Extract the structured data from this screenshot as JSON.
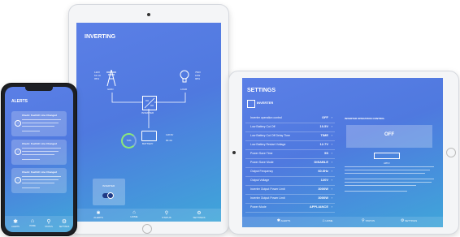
{
  "center_tablet": {
    "title": "INVERTING",
    "grid_values": [
      "120V",
      "61.1A",
      "95%"
    ],
    "load_values": [
      "750V",
      "10W",
      "98%"
    ],
    "inverter_label": "INVERTER",
    "battery_label": "BATTERY",
    "battery_percent": "73%",
    "battery_values": [
      "118.9V",
      "90.4A"
    ],
    "grid_label": "GRID",
    "load_label": "LOAD",
    "toggle_label": "INVERTER",
    "nav": [
      "ALERTS",
      "HOME",
      "STATUS",
      "SETTINGS"
    ]
  },
  "right_tablet": {
    "title": "SETTINGS",
    "subtitle": "INVERTER",
    "rows": [
      {
        "label": "Inverter operation control",
        "value": "OFF"
      },
      {
        "label": "Low Battery Cut Off",
        "value": "10.5V"
      },
      {
        "label": "Low Battery Cut Off Delay Time",
        "value": "TIME"
      },
      {
        "label": "Low Battery Restart Voltage",
        "value": "12.7V"
      },
      {
        "label": "Power Save Time",
        "value": "5S"
      },
      {
        "label": "Power Save Mode",
        "value": "DISABLE"
      },
      {
        "label": "Output Frequency",
        "value": "60.0Hz"
      },
      {
        "label": "Output Voltage",
        "value": "120V"
      },
      {
        "label": "Inverter Output Power Limit",
        "value": "3000W"
      },
      {
        "label": "Inverter Output Power Limit",
        "value": "3000W"
      },
      {
        "label": "Power Mode",
        "value": "APPLIANCE"
      }
    ],
    "panel_title": "INVERTER OPERATION CONTROL",
    "panel_state": "OFF",
    "panel_button": "APPLY",
    "nav": [
      "ALERTS",
      "HOME",
      "STATUS",
      "SETTINGS"
    ]
  },
  "phone": {
    "title": "ALERTS",
    "alert_title": "Check: Fuel/AC Line Changed",
    "nav": [
      "ALERTS",
      "HOME",
      "STATUS",
      "SETTINGS"
    ]
  },
  "colors": {
    "accent": "#4f79df",
    "gradient_end": "#3fa6d9",
    "toggle": "#1f3a86"
  }
}
